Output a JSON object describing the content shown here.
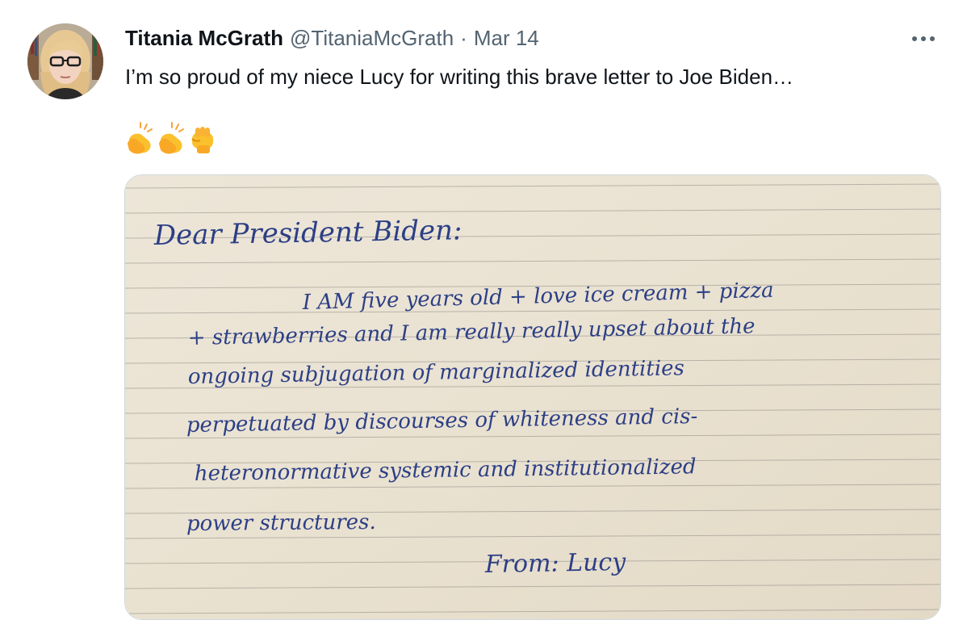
{
  "author": {
    "display_name": "Titania McGrath",
    "handle": "@TitaniaMcGrath",
    "separator": "·",
    "date": "Mar 14"
  },
  "tweet": {
    "text": "I’m so proud of my niece Lucy for writing this brave letter to Joe Biden…",
    "emojis": [
      "clapping-hands-emoji",
      "clapping-hands-emoji",
      "raised-fist-emoji"
    ]
  },
  "letter": {
    "greeting": "Dear President Biden:",
    "lines": [
      "I AM five years old + love ice cream + pizza",
      "+ strawberries and I am really really upset about the",
      "ongoing subjugation of marginalized identities",
      "perpetuated by discourses of whiteness and cis-",
      "heteronormative systemic and institutionalized",
      "power structures."
    ],
    "signature": "From: Lucy"
  },
  "colors": {
    "text_primary": "#0f1419",
    "text_secondary": "#536471",
    "paper": "#ece4d4",
    "ruled_line": "#8f8b86",
    "ink": "#2c3f86"
  },
  "icons": {
    "more": "more-horizontal-icon"
  }
}
